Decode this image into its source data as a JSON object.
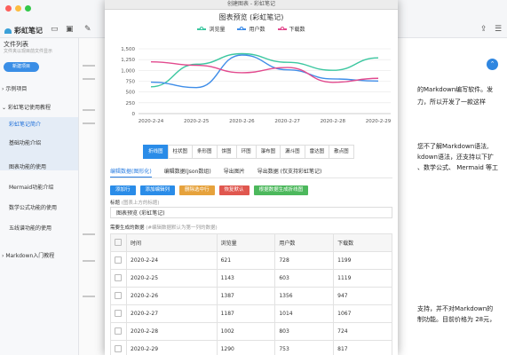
{
  "app": {
    "name": "彩虹笔记",
    "sidebar": {
      "title": "文件列表",
      "subtitle": "文件夹以现目前文件显示",
      "new_button": "新建项目",
      "folders": [
        {
          "label": "示例项目"
        },
        {
          "label": "彩虹笔记使用教程"
        },
        {
          "label": "Markdown入门教程"
        }
      ],
      "docs": [
        {
          "label": "彩虹笔记简介"
        },
        {
          "label": "基础功能介绍"
        },
        {
          "label": "图表功能的使用"
        },
        {
          "label": "Mermaid功能介绍"
        },
        {
          "label": "数学公式功能的使用"
        },
        {
          "label": "五线谱功能的使用"
        }
      ]
    },
    "preview_lines": [
      "的Markdown编写软件。发",
      "力，所以开发了一款这样",
      "您不了解Markdown语法,",
      "kdown语法，还支持以下扩",
      "、数学公式、 Mermaid 等工",
      "支持，并不对Markdown的",
      "制功能。目前价格为 28元，"
    ]
  },
  "modal": {
    "window_title": "创建图表 - 彩虹笔记",
    "chart_types": [
      "折线图",
      "柱状图",
      "条形图",
      "饼图",
      "环图",
      "瀑布图",
      "漏斗图",
      "雷达图",
      "散点图"
    ],
    "tabs": [
      "编辑数据(图形化)",
      "编辑数据(Json数组)",
      "导出图片",
      "导出数据 (仅支持彩虹笔记)"
    ],
    "actions": [
      {
        "label": "添加行",
        "color": "#2a8ce8"
      },
      {
        "label": "添加编辑列",
        "color": "#2a8ce8"
      },
      {
        "label": "删除选中行",
        "color": "#e6a23c"
      },
      {
        "label": "恢复默认",
        "color": "#e0574f"
      },
      {
        "label": "根据数据生成折线图",
        "color": "#4cb85c"
      }
    ],
    "title_label": "标题",
    "title_hint": "(图表上方的标题)",
    "title_value": "图表预览 (彩虹笔记)",
    "data_label": "需要生成的数据",
    "data_hint": "(#编辑数据默认为第一列的数据)",
    "table": {
      "headers": [
        "时间",
        "浏览量",
        "用户数",
        "下载数"
      ],
      "rows": [
        [
          "2020-2-24",
          "621",
          "728",
          "1199"
        ],
        [
          "2020-2-25",
          "1143",
          "603",
          "1119"
        ],
        [
          "2020-2-26",
          "1387",
          "1356",
          "947"
        ],
        [
          "2020-2-27",
          "1187",
          "1014",
          "1067"
        ],
        [
          "2020-2-28",
          "1002",
          "803",
          "724"
        ],
        [
          "2020-2-29",
          "1290",
          "753",
          "817"
        ]
      ]
    }
  },
  "chart_data": {
    "type": "line",
    "title": "图表预览 (彩虹笔记)",
    "x": [
      "2020-2-24",
      "2020-2-25",
      "2020-2-26",
      "2020-2-27",
      "2020-2-28",
      "2020-2-29"
    ],
    "ylim": [
      0,
      1500
    ],
    "yticks": [
      0,
      250,
      500,
      750,
      1000,
      1250,
      1500
    ],
    "ytick_labels": [
      "0",
      "250",
      "500",
      "750",
      "1,000",
      "1,250",
      "1,500"
    ],
    "grid": true,
    "legend": "top-center",
    "series": [
      {
        "name": "浏览量",
        "values": [
          621,
          1143,
          1387,
          1187,
          1002,
          1290
        ],
        "color": "#3cc7a0"
      },
      {
        "name": "用户数",
        "values": [
          728,
          603,
          1356,
          1014,
          803,
          753
        ],
        "color": "#3f8de8"
      },
      {
        "name": "下载数",
        "values": [
          1199,
          1119,
          947,
          1067,
          724,
          817
        ],
        "color": "#e24a8e"
      }
    ]
  }
}
